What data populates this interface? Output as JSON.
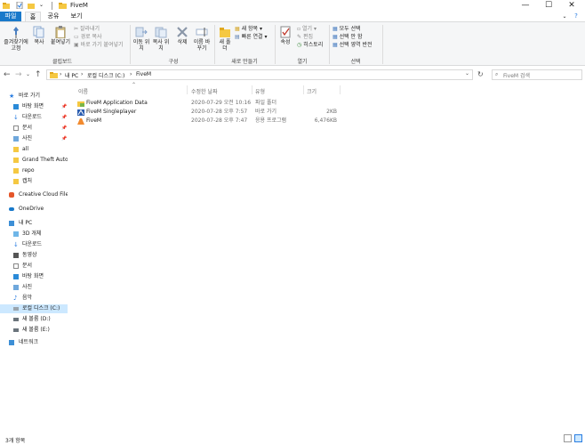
{
  "window": {
    "title": "FiveM",
    "controls": {
      "minimize": "—",
      "maximize": "☐",
      "close": "✕"
    }
  },
  "ribbon": {
    "tabs": [
      "파일",
      "홈",
      "공유",
      "보기"
    ],
    "clipboard": {
      "pin_label": "즐겨찾기에 고정",
      "copy_label": "복사",
      "paste_label": "붙여넣기",
      "cut_label": "잘라내기",
      "copy_path_label": "경로 복사",
      "paste_shortcut_label": "바로 가기 붙여넣기",
      "group": "클립보드"
    },
    "organize": {
      "move_label": "이동 위치",
      "copyto_label": "복사 위치",
      "delete_label": "삭제",
      "rename_label": "이름 바꾸기",
      "group": "구성"
    },
    "new": {
      "newfolder_label": "새 폴더",
      "newitem_label": "새 항목",
      "easyaccess_label": "빠른 연결",
      "group": "새로 만들기"
    },
    "open": {
      "properties_label": "속성",
      "open_label": "열기",
      "edit_label": "편집",
      "history_label": "히스토리",
      "group": "열기"
    },
    "select": {
      "selectall_label": "모두 선택",
      "selectnone_label": "선택 안 함",
      "invert_label": "선택 영역 반전",
      "group": "선택"
    }
  },
  "address": {
    "crumbs": [
      "내 PC",
      "로컬 디스크 (C:)",
      "FiveM"
    ],
    "search_placeholder": "FiveM 검색"
  },
  "nav": {
    "quick_access": "바로 가기",
    "quick_items": [
      "바탕 화면",
      "다운로드",
      "문서",
      "사진",
      "all",
      "Grand Theft Auto V",
      "repo",
      "캡처"
    ],
    "creative_cloud": "Creative Cloud Files",
    "onedrive": "OneDrive",
    "thispc": "내 PC",
    "pc_items": [
      "3D 개체",
      "다운로드",
      "동영상",
      "문서",
      "바탕 화면",
      "사진",
      "음악",
      "로컬 디스크 (C:)",
      "새 볼륨 (D:)",
      "새 볼륨 (E:)"
    ],
    "network": "네트워크"
  },
  "columns": {
    "name": "이름",
    "modified": "수정한 날짜",
    "type": "유형",
    "size": "크기"
  },
  "files": [
    {
      "name": "FiveM Application Data",
      "modified": "2020-07-29 오전 10:16",
      "type": "파일 폴더",
      "size": ""
    },
    {
      "name": "FiveM Singleplayer",
      "modified": "2020-07-28 오후 7:57",
      "type": "바로 가기",
      "size": "2KB"
    },
    {
      "name": "FiveM",
      "modified": "2020-07-28 오후 7:47",
      "type": "응용 프로그램",
      "size": "6,476KB"
    }
  ],
  "status": {
    "count": "3개 항목"
  },
  "colors": {
    "accent": "#1979ca",
    "folder": "#f5c842",
    "selection": "#cce8ff"
  }
}
